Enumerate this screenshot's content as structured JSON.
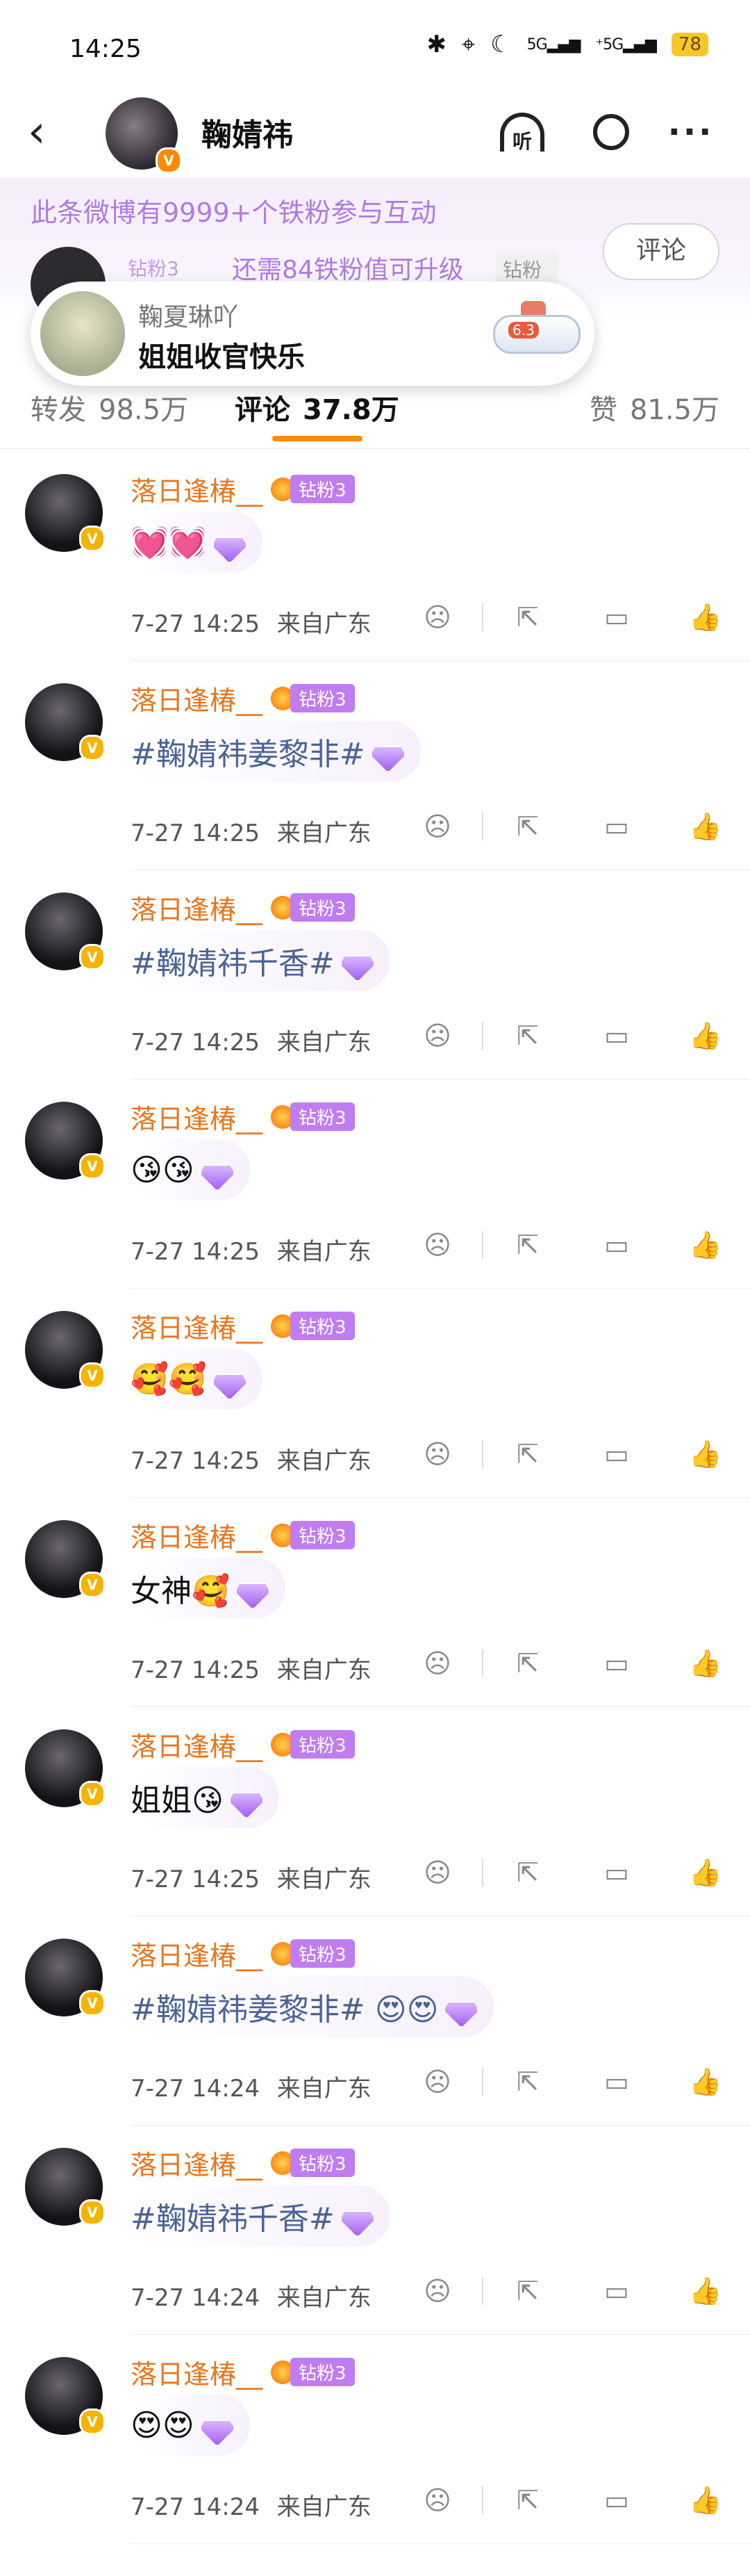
{
  "status_bar": {
    "time": "14:25",
    "signal1": "5G",
    "signal2": "⁺5G",
    "battery": "78"
  },
  "header": {
    "name": "鞠婧祎",
    "listen_label": "听"
  },
  "fan_bar": {
    "headline": "此条微博有9999+个铁粉参与互动",
    "current_tag": "钻粉3",
    "upgrade_text": "还需84铁粉值可升级",
    "next_tag": "钻粉4",
    "comment_button": "评论"
  },
  "popup": {
    "name": "鞠夏琳吖",
    "message": "姐姐收官快乐",
    "plane_badge": "6.3"
  },
  "tabs": {
    "forward": {
      "label": "转发",
      "count": "98.5万"
    },
    "comments": {
      "label": "评论",
      "count": "37.8万"
    },
    "likes": {
      "label": "赞",
      "count": "81.5万"
    }
  },
  "comments": [
    {
      "user": "落日逢椿__",
      "tag": "钻粉3",
      "text": "💓💓",
      "topic": false,
      "time": "7-27  14:25",
      "location": "来自广东"
    },
    {
      "user": "落日逢椿__",
      "tag": "钻粉3",
      "text": "#鞠婧祎姜黎非#",
      "topic": true,
      "time": "7-27  14:25",
      "location": "来自广东"
    },
    {
      "user": "落日逢椿__",
      "tag": "钻粉3",
      "text": "#鞠婧祎千香#",
      "topic": true,
      "time": "7-27  14:25",
      "location": "来自广东"
    },
    {
      "user": "落日逢椿__",
      "tag": "钻粉3",
      "text": "😘😘",
      "topic": false,
      "time": "7-27  14:25",
      "location": "来自广东"
    },
    {
      "user": "落日逢椿__",
      "tag": "钻粉3",
      "text": "🥰🥰",
      "topic": false,
      "time": "7-27  14:25",
      "location": "来自广东"
    },
    {
      "user": "落日逢椿__",
      "tag": "钻粉3",
      "text": "女神🥰",
      "topic": false,
      "time": "7-27  14:25",
      "location": "来自广东"
    },
    {
      "user": "落日逢椿__",
      "tag": "钻粉3",
      "text": "姐姐😘",
      "topic": false,
      "time": "7-27  14:25",
      "location": "来自广东"
    },
    {
      "user": "落日逢椿__",
      "tag": "钻粉3",
      "text": "#鞠婧祎姜黎非# 😍😍",
      "topic": true,
      "time": "7-27  14:24",
      "location": "来自广东"
    },
    {
      "user": "落日逢椿__",
      "tag": "钻粉3",
      "text": "#鞠婧祎千香#",
      "topic": true,
      "time": "7-27  14:24",
      "location": "来自广东"
    },
    {
      "user": "落日逢椿__",
      "tag": "钻粉3",
      "text": "😍😍",
      "topic": false,
      "time": "7-27  14:24",
      "location": "来自广东"
    }
  ]
}
